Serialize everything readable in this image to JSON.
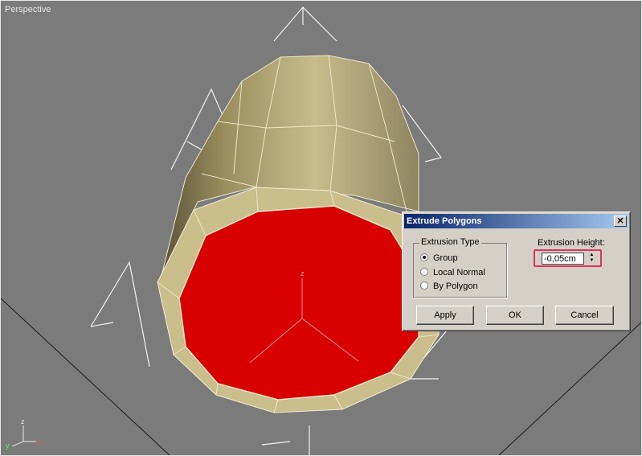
{
  "viewport": {
    "label": "Perspective",
    "axis_labels": {
      "x": "x",
      "y": "y",
      "z": "z"
    }
  },
  "dialog": {
    "title": "Extrude Polygons",
    "close_glyph": "✕",
    "extrusion_type": {
      "label": "Extrusion Type",
      "options": [
        "Group",
        "Local Normal",
        "By Polygon"
      ],
      "selected": "Group"
    },
    "extrusion_height": {
      "label": "Extrusion Height:",
      "value": "-0,05cm"
    },
    "buttons": {
      "apply": "Apply",
      "ok": "OK",
      "cancel": "Cancel"
    }
  },
  "colors": {
    "viewport_bg": "#7b7b7b",
    "selected_face": "#d80000",
    "mesh": "#b5aa7c",
    "highlight": "#e3305a"
  }
}
